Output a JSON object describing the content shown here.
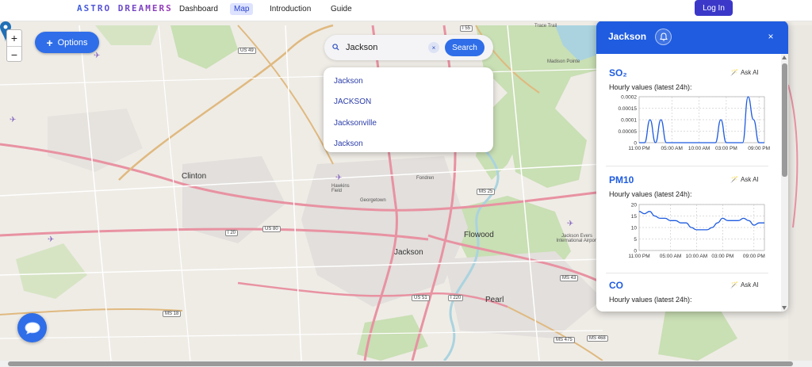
{
  "nav": {
    "brand": "ASTRO DREAMERS",
    "links": [
      "Dashboard",
      "Map",
      "Introduction",
      "Guide"
    ],
    "active": "Map",
    "login": "Log In"
  },
  "map": {
    "zoom_in": "+",
    "zoom_out": "−",
    "options_label": "Options",
    "labels": {
      "clinton": "Clinton",
      "jackson": "Jackson",
      "flowood": "Flowood",
      "pearl": "Pearl",
      "georgetown": "Georgetown",
      "fondren": "Fondren",
      "hawkins": "Hawkins Field",
      "airport": "Jackson Evers International Airport",
      "madison": "Madison Pointe",
      "trace": "Trace Trail"
    },
    "shields": [
      "US 49",
      "I 55",
      "US 80",
      "I 20",
      "MS 25",
      "MS 18",
      "MS 475",
      "MS 468",
      "MS 43",
      "I 220",
      "US 51"
    ]
  },
  "search": {
    "value": "Jackson",
    "clear": "×",
    "button": "Search",
    "results": [
      "Jackson",
      "JACKSON",
      "Jacksonville",
      "Jackson"
    ]
  },
  "panel": {
    "title": "Jackson",
    "close": "×",
    "ask_ai": "Ask AI",
    "hourly_label": "Hourly values (latest 24h):",
    "pollutants": [
      "SO₂",
      "PM10",
      "CO"
    ],
    "colors": {
      "header": "#1f5ce0",
      "line": "#1f5ce0"
    }
  },
  "chart_data": [
    {
      "type": "line",
      "title": "SO₂",
      "subtitle": "Hourly values (latest 24h):",
      "x": [
        "11:00 PM",
        "12:00 AM",
        "01:00 AM",
        "02:00 AM",
        "03:00 AM",
        "04:00 AM",
        "05:00 AM",
        "06:00 AM",
        "07:00 AM",
        "08:00 AM",
        "09:00 AM",
        "10:00 AM",
        "11:00 AM",
        "12:00 PM",
        "01:00 PM",
        "02:00 PM",
        "03:00 PM",
        "04:00 PM",
        "05:00 PM",
        "06:00 PM",
        "07:00 PM",
        "08:00 PM",
        "09:00 PM",
        "10:00 PM"
      ],
      "xticks": [
        "11:00 PM",
        "05:00 AM",
        "10:00 AM",
        "03:00 PM",
        "09:00 PM"
      ],
      "yticks": [
        "0",
        "0.00005",
        "0.0001",
        "0.00015",
        "0.0002"
      ],
      "ylim": [
        0,
        0.0002
      ],
      "values": [
        0,
        0,
        0.0001,
        0,
        0.0001,
        0,
        0,
        0,
        0,
        0,
        0,
        0,
        0,
        0,
        0,
        0.0001,
        0,
        0,
        0,
        0,
        0.0002,
        0.0001,
        0,
        0
      ],
      "grid": true
    },
    {
      "type": "line",
      "title": "PM10",
      "subtitle": "Hourly values (latest 24h):",
      "x": [
        "11:00 PM",
        "12:00 AM",
        "01:00 AM",
        "02:00 AM",
        "03:00 AM",
        "04:00 AM",
        "05:00 AM",
        "06:00 AM",
        "07:00 AM",
        "08:00 AM",
        "09:00 AM",
        "10:00 AM",
        "11:00 AM",
        "12:00 PM",
        "01:00 PM",
        "02:00 PM",
        "03:00 PM",
        "04:00 PM",
        "05:00 PM",
        "06:00 PM",
        "07:00 PM",
        "08:00 PM",
        "09:00 PM",
        "10:00 PM"
      ],
      "xticks": [
        "11:00 PM",
        "05:00 AM",
        "10:00 AM",
        "03:00 PM",
        "09:00 PM"
      ],
      "yticks": [
        "0",
        "5",
        "10",
        "15",
        "20"
      ],
      "ylim": [
        0,
        20
      ],
      "values": [
        17,
        16,
        17,
        15,
        14,
        14,
        13,
        13,
        12,
        12,
        10,
        9,
        9,
        9,
        10,
        12,
        14,
        13,
        13,
        13,
        14,
        13,
        11,
        12,
        12
      ],
      "grid": true
    },
    {
      "type": "line",
      "title": "CO",
      "subtitle": "Hourly values (latest 24h):"
    }
  ]
}
